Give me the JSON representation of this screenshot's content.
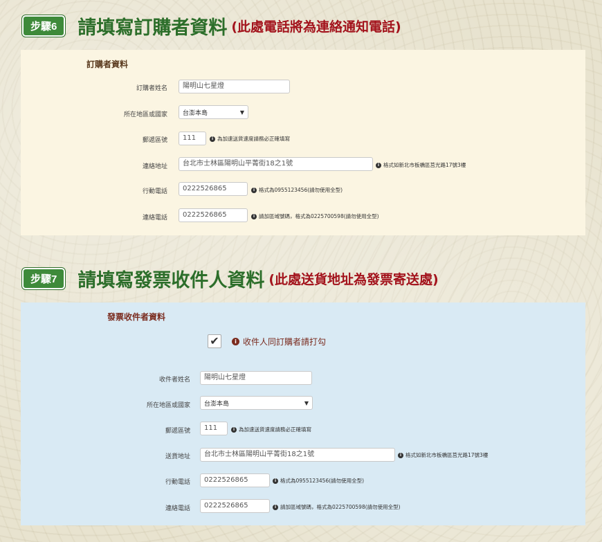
{
  "step6": {
    "badge": "步驟6",
    "title": "請填寫訂購者資料",
    "note": "(此處電話將為連絡通知電話)",
    "panel_title": "訂購者資料",
    "name_label": "訂購者姓名",
    "name_value": "陽明山七星燈",
    "region_label": "所在地區或國家",
    "region_value": "台澎本島",
    "zip_label": "郵遞區號",
    "zip_value": "111",
    "zip_hint": "為加速送貨速度請務必正確填寫",
    "address_label": "連絡地址",
    "address_value": "台北市士林區陽明山平菁街18之1號",
    "address_hint": "格式如新北市板橋區莒光路17號3樓",
    "mobile_label": "行動電話",
    "mobile_value": "0222526865",
    "mobile_hint": "格式為0955123456(請勿使用全型)",
    "phone_label": "連絡電話",
    "phone_value": "0222526865",
    "phone_hint": "請加區域號碼，格式為0225700598(請勿使用全型)"
  },
  "step7": {
    "badge": "步驟7",
    "title": "請填寫發票收件人資料",
    "note": "(此處送貨地址為發票寄送處)",
    "panel_title": "發票收件者資料",
    "same_checkbox_label": "收件人同訂購者請打勾",
    "same_checked": true,
    "name_label": "收件者姓名",
    "name_value": "陽明山七星燈",
    "region_label": "所在地區或國家",
    "region_value": "台澎本島",
    "zip_label": "郵遞區號",
    "zip_value": "111",
    "zip_hint": "為加速送貨速度請務必正確填寫",
    "address_label": "送貨地址",
    "address_value": "台北市士林區陽明山平菁街18之1號",
    "address_hint": "格式如新北市板橋區莒光路17號3樓",
    "mobile_label": "行動電話",
    "mobile_value": "0222526865",
    "mobile_hint": "格式為0955123456(請勿使用全型)",
    "phone_label": "連絡電話",
    "phone_value": "0222526865",
    "phone_hint": "請加區域號碼，格式為0225700598(請勿使用全型)"
  },
  "colors": {
    "step_badge": "#3e8a3a",
    "title_green": "#2c6e2a",
    "note_red": "#a3131c",
    "panel_cream": "#fbf5e2",
    "panel_blue": "#d9eaf4"
  }
}
